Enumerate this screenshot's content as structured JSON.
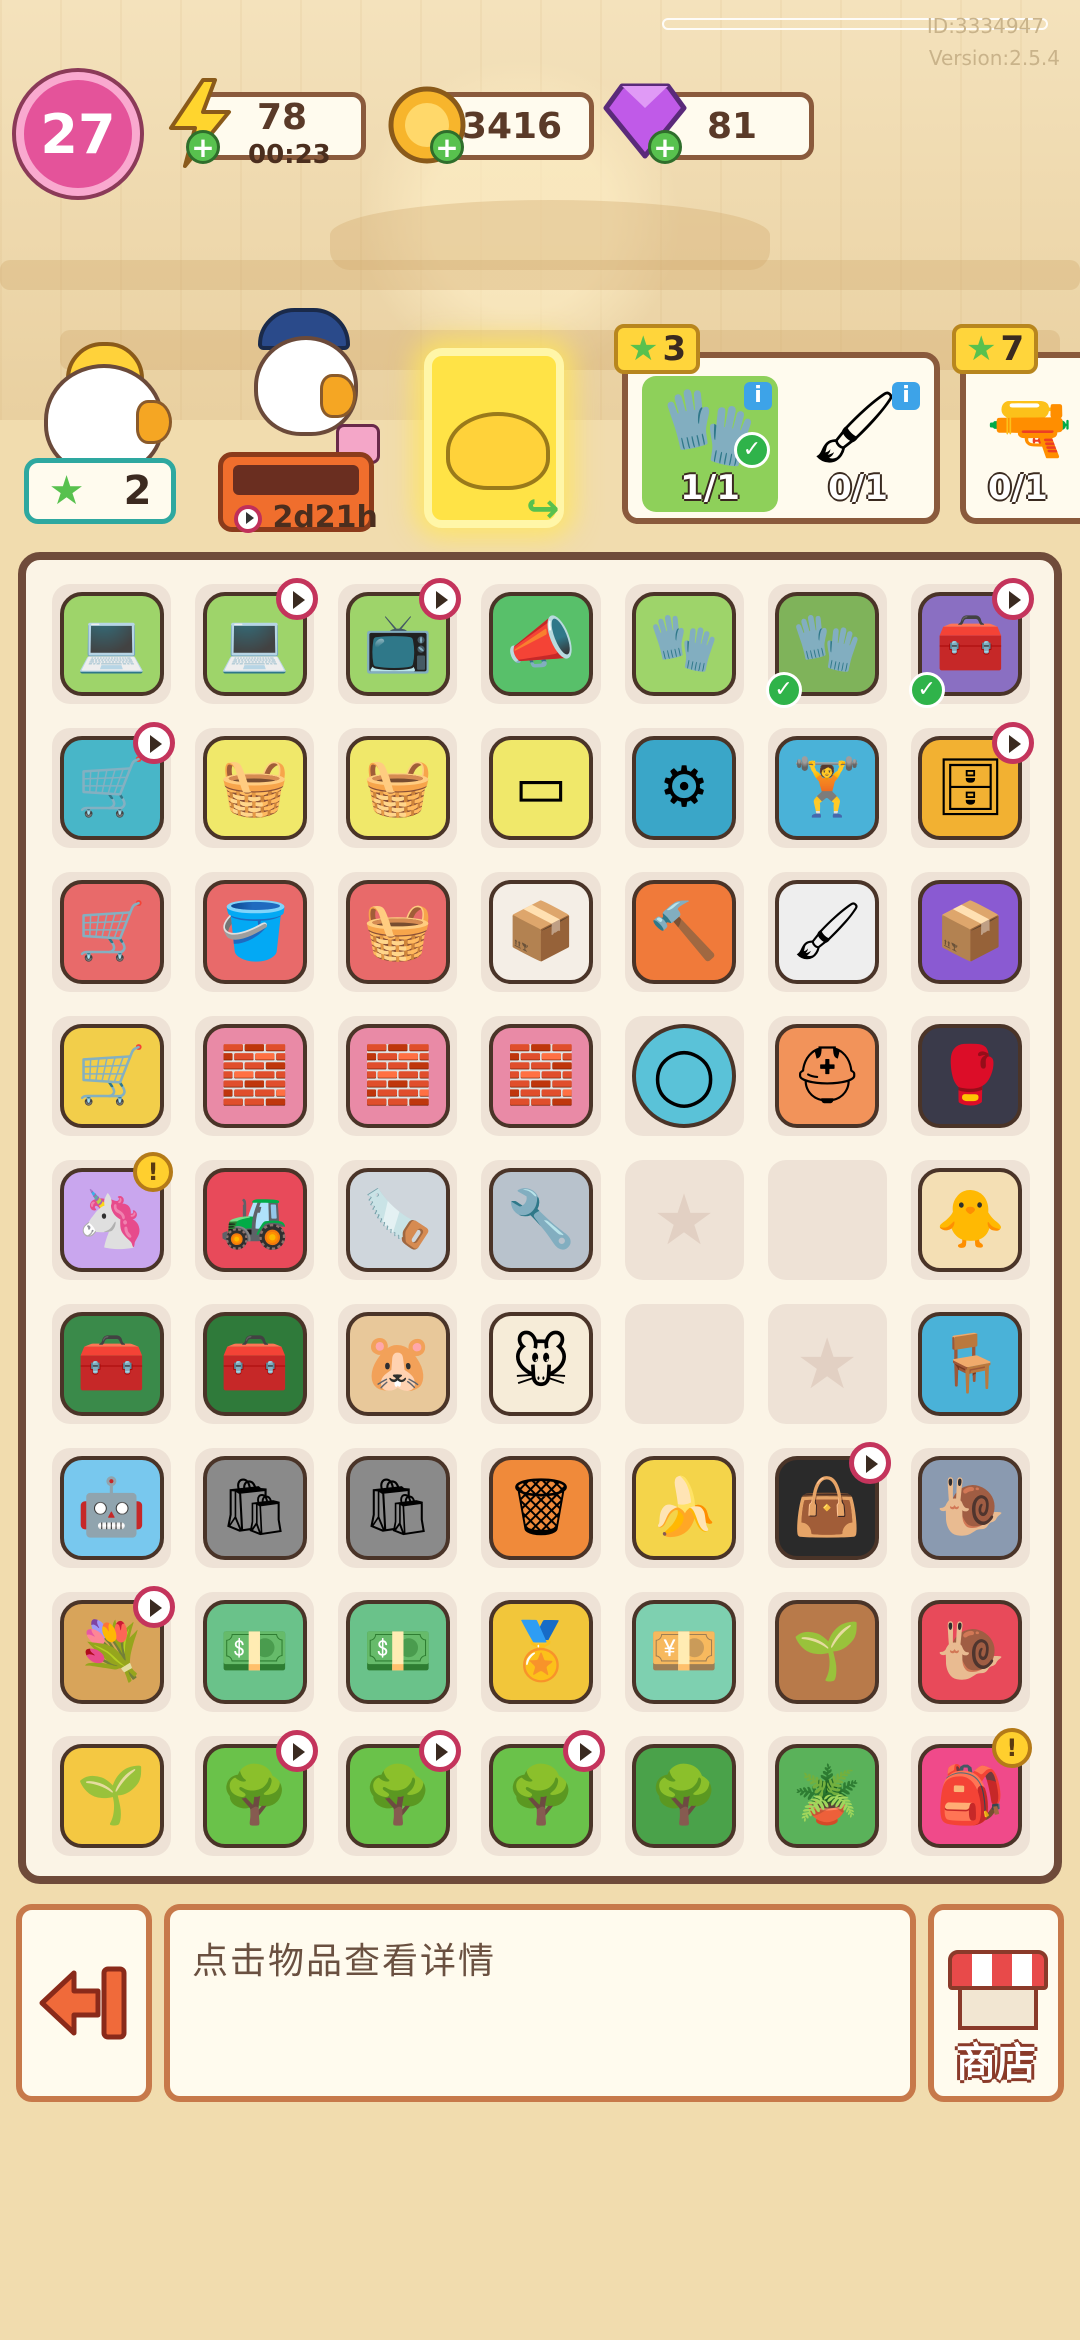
{
  "header": {
    "id_text": "ID:3334947",
    "version_text": "Version:2.5.4",
    "level": "27",
    "energy": {
      "value": "78",
      "timer": "00:23",
      "icon": "lightning-icon"
    },
    "coins": {
      "value": "3416",
      "icon": "coin-icon"
    },
    "gems": {
      "value": "81",
      "icon": "gem-icon"
    }
  },
  "characters": {
    "worker": {
      "stars": "2",
      "icon": "star-icon"
    },
    "courier": {
      "cooldown": "2d21h"
    }
  },
  "orders": [
    {
      "reward": "3",
      "slots": [
        {
          "item": "garden-gloves",
          "count": "1/1",
          "done": true
        },
        {
          "item": "roller-brush",
          "count": "0/1",
          "done": false
        }
      ]
    },
    {
      "reward": "7",
      "slots": [
        {
          "item": "power-drill",
          "count": "0/1",
          "done": false
        }
      ]
    }
  ],
  "board": {
    "cells": [
      {
        "name": "laptop",
        "emoji": "💻",
        "bg": "#9ed46a",
        "clock": false
      },
      {
        "name": "laptop",
        "emoji": "💻",
        "bg": "#9ed46a",
        "clock": true
      },
      {
        "name": "retro-tv",
        "emoji": "📺",
        "bg": "#9ed46a",
        "clock": true
      },
      {
        "name": "megaphone",
        "emoji": "📣",
        "bg": "#58c06a"
      },
      {
        "name": "gloves",
        "emoji": "🧤",
        "bg": "#9ed46a"
      },
      {
        "name": "work-gloves",
        "emoji": "🧤",
        "bg": "#7fb35a",
        "check": true
      },
      {
        "name": "toolbox-bag",
        "emoji": "🧰",
        "bg": "#8a6fc2",
        "clock": true,
        "check": true
      },
      {
        "name": "tool-cart",
        "emoji": "🛒",
        "bg": "#48b6c8",
        "clock": true
      },
      {
        "name": "basket-weights",
        "emoji": "🧺",
        "bg": "#f0e86a"
      },
      {
        "name": "basket",
        "emoji": "🧺",
        "bg": "#f0e86a"
      },
      {
        "name": "tray",
        "emoji": "▭",
        "bg": "#f0e86a"
      },
      {
        "name": "ab-roller",
        "emoji": "⚙",
        "bg": "#3aa6c8"
      },
      {
        "name": "bench-press",
        "emoji": "🏋",
        "bg": "#4ab2d8"
      },
      {
        "name": "cabinet",
        "emoji": "🗄",
        "bg": "#f2b132",
        "clock": true
      },
      {
        "name": "wheelbarrow",
        "emoji": "🛒",
        "bg": "#e86a6a"
      },
      {
        "name": "bucket-tools",
        "emoji": "🪣",
        "bg": "#e86a6a"
      },
      {
        "name": "basket-trowel",
        "emoji": "🧺",
        "bg": "#e86a6a"
      },
      {
        "name": "box-tools",
        "emoji": "📦",
        "bg": "#f4eee6"
      },
      {
        "name": "mallet",
        "emoji": "🔨",
        "bg": "#f07a3a"
      },
      {
        "name": "roller-brush",
        "emoji": "🖌",
        "bg": "#eeeeee"
      },
      {
        "name": "purple-box",
        "emoji": "📦",
        "bg": "#8a5ad2"
      },
      {
        "name": "duck-cart",
        "emoji": "🛒",
        "bg": "#f2ce4a"
      },
      {
        "name": "brick-pile",
        "emoji": "🧱",
        "bg": "#e98aa6"
      },
      {
        "name": "bricks",
        "emoji": "🧱",
        "bg": "#e98aa6"
      },
      {
        "name": "brick",
        "emoji": "🧱",
        "bg": "#e98aa6"
      },
      {
        "name": "hula-hoop",
        "emoji": "◯",
        "bg": "#5ac2d8",
        "round": true
      },
      {
        "name": "hard-hat",
        "emoji": "⛑",
        "bg": "#f2935a"
      },
      {
        "name": "boxing-glove",
        "emoji": "🥊",
        "bg": "#3a3a4a"
      },
      {
        "name": "swim-ring",
        "emoji": "🦄",
        "bg": "#c9a6ee",
        "alert": true
      },
      {
        "name": "toy-truck",
        "emoji": "🚜",
        "bg": "#e84a5a"
      },
      {
        "name": "hacksaw",
        "emoji": "🪚",
        "bg": "#cfd6dc"
      },
      {
        "name": "wrench",
        "emoji": "🔧",
        "bg": "#b8c2cc"
      },
      {
        "name": "empty-star",
        "empty": true
      },
      {
        "name": "empty",
        "blank": true
      },
      {
        "name": "coin-duck",
        "emoji": "🐥",
        "bg": "#f4dfb4"
      },
      {
        "name": "green-toolbox",
        "emoji": "🧰",
        "bg": "#3a8a4a"
      },
      {
        "name": "open-toolbox",
        "emoji": "🧰",
        "bg": "#2f7a3a"
      },
      {
        "name": "hamsters",
        "emoji": "🐹",
        "bg": "#e8c89a"
      },
      {
        "name": "mouse",
        "emoji": "🐭",
        "bg": "#f6ecd8"
      },
      {
        "name": "empty",
        "blank": true
      },
      {
        "name": "empty-star",
        "empty": true
      },
      {
        "name": "sit-up-bench",
        "emoji": "🪑",
        "bg": "#4ab2d8"
      },
      {
        "name": "robot-vacuum",
        "emoji": "🤖",
        "bg": "#78c8ee"
      },
      {
        "name": "trash-bag",
        "emoji": "🛍",
        "bg": "#8a8a8a"
      },
      {
        "name": "trash-bag",
        "emoji": "🛍",
        "bg": "#8a8a8a"
      },
      {
        "name": "bin",
        "emoji": "🗑",
        "bg": "#f08a3a"
      },
      {
        "name": "banana-peel",
        "emoji": "🍌",
        "bg": "#f4d44a"
      },
      {
        "name": "gym-bag",
        "emoji": "👜",
        "bg": "#2a2a2a",
        "clock": true
      },
      {
        "name": "snail",
        "emoji": "🐌",
        "bg": "#8a9ab0"
      },
      {
        "name": "flower-basket",
        "emoji": "💐",
        "bg": "#d8a45a",
        "clock": true
      },
      {
        "name": "cash-stack",
        "emoji": "💵",
        "bg": "#6ac28a"
      },
      {
        "name": "cash-pile",
        "emoji": "💵",
        "bg": "#6ac28a"
      },
      {
        "name": "medal",
        "emoji": "🏅",
        "bg": "#f2c63a"
      },
      {
        "name": "bills",
        "emoji": "💴",
        "bg": "#7ed0b0"
      },
      {
        "name": "seedling",
        "emoji": "🌱",
        "bg": "#b87a4a"
      },
      {
        "name": "cat-snail",
        "emoji": "🐌",
        "bg": "#e84a5a"
      },
      {
        "name": "sprout-pot",
        "emoji": "🌱",
        "bg": "#f4c842"
      },
      {
        "name": "flower-tree",
        "emoji": "🌳",
        "bg": "#6ac24a",
        "clock": true
      },
      {
        "name": "flower-tree",
        "emoji": "🌳",
        "bg": "#6ac24a",
        "clock": true
      },
      {
        "name": "flower-tree",
        "emoji": "🌳",
        "bg": "#6ac24a",
        "clock": true
      },
      {
        "name": "potted-tree",
        "emoji": "🌳",
        "bg": "#4aa24a"
      },
      {
        "name": "potted-plant",
        "emoji": "🪴",
        "bg": "#5ab25a"
      },
      {
        "name": "backpack",
        "emoji": "🎒",
        "bg": "#f04a8a",
        "alert": true
      }
    ]
  },
  "bottom": {
    "info_text": "点击物品查看详情",
    "shop_label": "商店",
    "exit_icon": "exit-icon",
    "shop_icon": "shop-icon"
  },
  "colors": {
    "background": "#f1dcae",
    "board_border": "#6f4b3a",
    "accent_pink": "#e4539a",
    "accent_green": "#58c14e"
  }
}
